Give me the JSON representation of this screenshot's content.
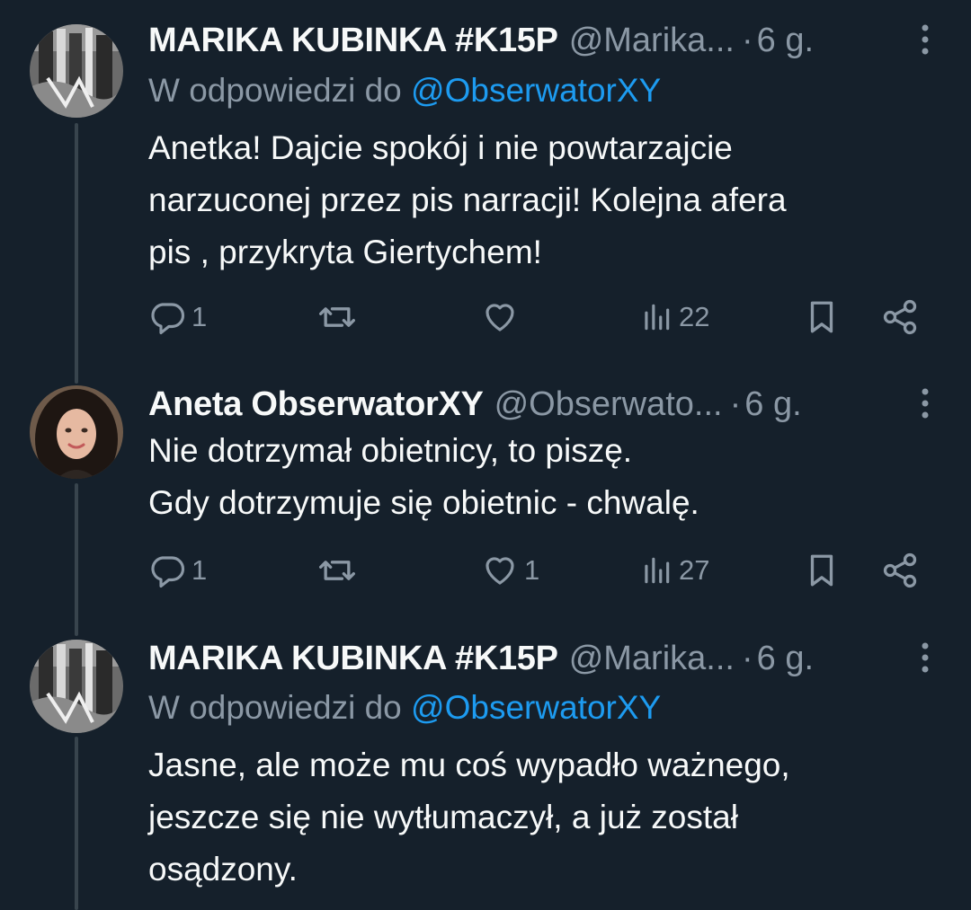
{
  "tweets": [
    {
      "author": {
        "name": "MARIKA KUBINKA #K15P",
        "handle": "@Marika...",
        "avatar": "photo-avatar-grayscale"
      },
      "separator": "·",
      "time": "6 g.",
      "reply_to": {
        "prefix": "W odpowiedzi do",
        "mention": "@ObserwatorXY"
      },
      "text_lines": [
        "Anetka! Dajcie spokój i nie powtarzajcie",
        "narzuconej przez pis narracji! Kolejna afera",
        "pis , przykryta Giertychem!"
      ],
      "stats": {
        "replies": "1",
        "retweets": "",
        "likes": "",
        "views": "22"
      }
    },
    {
      "author": {
        "name": "Aneta ObserwatorXY",
        "handle": "@Obserwato...",
        "avatar": "photo-avatar-woman"
      },
      "separator": "·",
      "time": "6 g.",
      "text_lines": [
        "Nie dotrzymał obietnicy, to piszę.",
        "Gdy dotrzymuje się obietnic - chwalę."
      ],
      "stats": {
        "replies": "1",
        "retweets": "",
        "likes": "1",
        "views": "27"
      }
    },
    {
      "author": {
        "name": "MARIKA KUBINKA #K15P",
        "handle": "@Marika...",
        "avatar": "photo-avatar-grayscale"
      },
      "separator": "·",
      "time": "6 g.",
      "reply_to": {
        "prefix": "W odpowiedzi do",
        "mention": "@ObserwatorXY"
      },
      "text_lines": [
        "Jasne, ale może mu coś wypadło ważnego,",
        "jeszcze się nie wytłumaczył, a już został",
        "osądzony."
      ]
    }
  ],
  "icons": {
    "reply": "reply-icon",
    "retweet": "retweet-icon",
    "like": "heart-icon",
    "views": "views-icon",
    "bookmark": "bookmark-icon",
    "share": "share-icon",
    "more": "more-icon"
  },
  "colors": {
    "background": "#15202b",
    "text": "#f7f9f9",
    "secondary": "#8b98a5",
    "link": "#1d9bf0",
    "thread_line": "#38444d"
  }
}
